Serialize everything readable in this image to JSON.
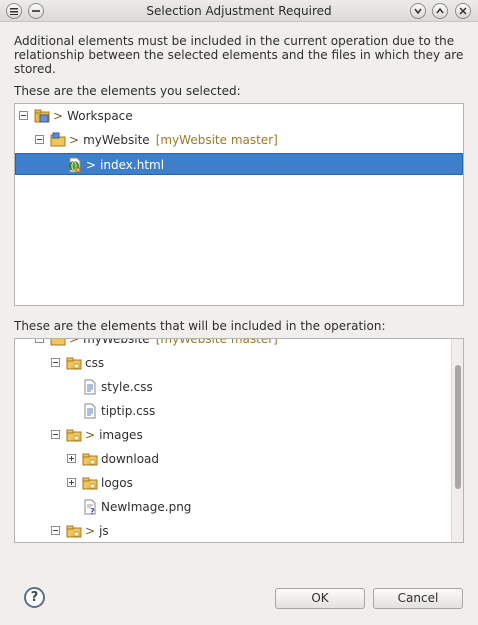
{
  "window": {
    "title": "Selection Adjustment Required"
  },
  "description": "Additional elements must be included in the current operation due to the relationship between the selected elements and the files in which they are stored.",
  "selected_label": "These are the elements you selected:",
  "selected_tree": [
    {
      "label": "Workspace",
      "arrow": ">",
      "repo": "",
      "expander": "minus",
      "icon": "workspace-icon",
      "level": 0,
      "selected": false
    },
    {
      "label": "myWebsite",
      "arrow": ">",
      "repo": "[myWebsite master]",
      "expander": "minus",
      "icon": "project-folder-icon",
      "level": 1,
      "selected": false
    },
    {
      "label": "index.html",
      "arrow": ">",
      "repo": "",
      "expander": "",
      "icon": "html-file-icon",
      "level": 2,
      "selected": true
    }
  ],
  "included_label": "These are the elements that will be included in the operation:",
  "included_tree": [
    {
      "label": "myWebsite",
      "arrow": ">",
      "repo": "[myWebsite master]",
      "expander": "minus",
      "icon": "project-folder-icon",
      "level": 1
    },
    {
      "label": "css",
      "arrow": "",
      "repo": "",
      "expander": "minus",
      "icon": "folder-icon",
      "level": 2
    },
    {
      "label": "style.css",
      "arrow": "",
      "repo": "",
      "expander": "",
      "icon": "file-icon",
      "level": 3
    },
    {
      "label": "tiptip.css",
      "arrow": "",
      "repo": "",
      "expander": "",
      "icon": "file-icon",
      "level": 3
    },
    {
      "label": "images",
      "arrow": ">",
      "repo": "",
      "expander": "minus",
      "icon": "folder-icon",
      "level": 2
    },
    {
      "label": "download",
      "arrow": "",
      "repo": "",
      "expander": "plus",
      "icon": "folder-icon",
      "level": 3
    },
    {
      "label": "logos",
      "arrow": "",
      "repo": "",
      "expander": "plus",
      "icon": "folder-icon",
      "level": 3
    },
    {
      "label": "NewImage.png",
      "arrow": "",
      "repo": "",
      "expander": "",
      "icon": "unknown-file-icon",
      "level": 3
    },
    {
      "label": "js",
      "arrow": ">",
      "repo": "",
      "expander": "minus",
      "icon": "folder-icon",
      "level": 2
    }
  ],
  "buttons": {
    "ok": "OK",
    "cancel": "Cancel",
    "help": "?"
  }
}
